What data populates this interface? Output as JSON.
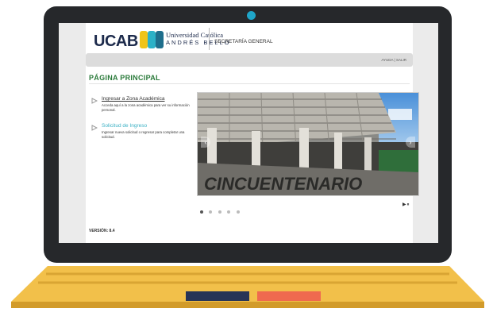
{
  "header": {
    "logo_text": "UCAB",
    "university_line1": "Universidad Católica",
    "university_line2": "ANDRÉS BELLO",
    "department": "SECRETARÍA GENERAL"
  },
  "topbar": {
    "help_label": "AYUDA",
    "separator": "|",
    "logout_label": "SALIR"
  },
  "main": {
    "title": "PÁGINA PRINCIPAL",
    "menu": [
      {
        "label": "Ingresar a Zona Académica",
        "description": "Acceda aquí a la zona académica para ver su información personal."
      },
      {
        "label": "Solicitud de Ingreso",
        "description": "Ingresar nueva solicitud o regresar para completar una solicitud."
      }
    ],
    "slideshow": {
      "caption_text": "CINCUENTENARIO",
      "slide_count": 5,
      "active_slide": 1,
      "play_pause_label": "▶⏸"
    }
  },
  "footer": {
    "version": "VERSIÓN: 8.4"
  },
  "colors": {
    "laptop_frame": "#26282b",
    "camera": "#1fa5c8",
    "title_green": "#2a7a3a",
    "link_teal": "#3ab0c4",
    "laptop_base": "#f2c04a",
    "key_navy": "#273456",
    "key_coral": "#ef6a4f"
  }
}
